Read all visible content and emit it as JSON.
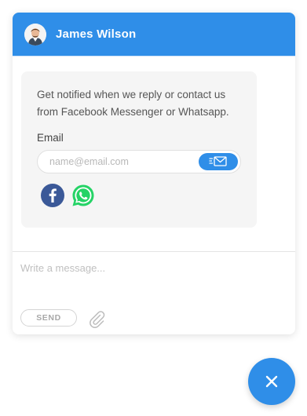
{
  "header": {
    "agent_name": "James Wilson",
    "avatar_icon": "person-avatar",
    "background_color": "#2f8ee8"
  },
  "notify_card": {
    "message": "Get notified when we reply or contact us from Facebook Messenger or Whatsapp.",
    "email_label": "Email",
    "email_placeholder": "name@email.com",
    "email_value": "",
    "submit_icon": "send-mail-icon",
    "channels": [
      {
        "name": "Facebook",
        "icon": "facebook-icon",
        "color": "#3b5998"
      },
      {
        "name": "WhatsApp",
        "icon": "whatsapp-icon",
        "color": "#25d366"
      }
    ]
  },
  "composer": {
    "placeholder": "Write a message...",
    "value": "",
    "send_label": "SEND",
    "attach_icon": "paperclip-icon"
  },
  "launcher": {
    "icon": "close-icon",
    "color": "#2f8ee8"
  }
}
